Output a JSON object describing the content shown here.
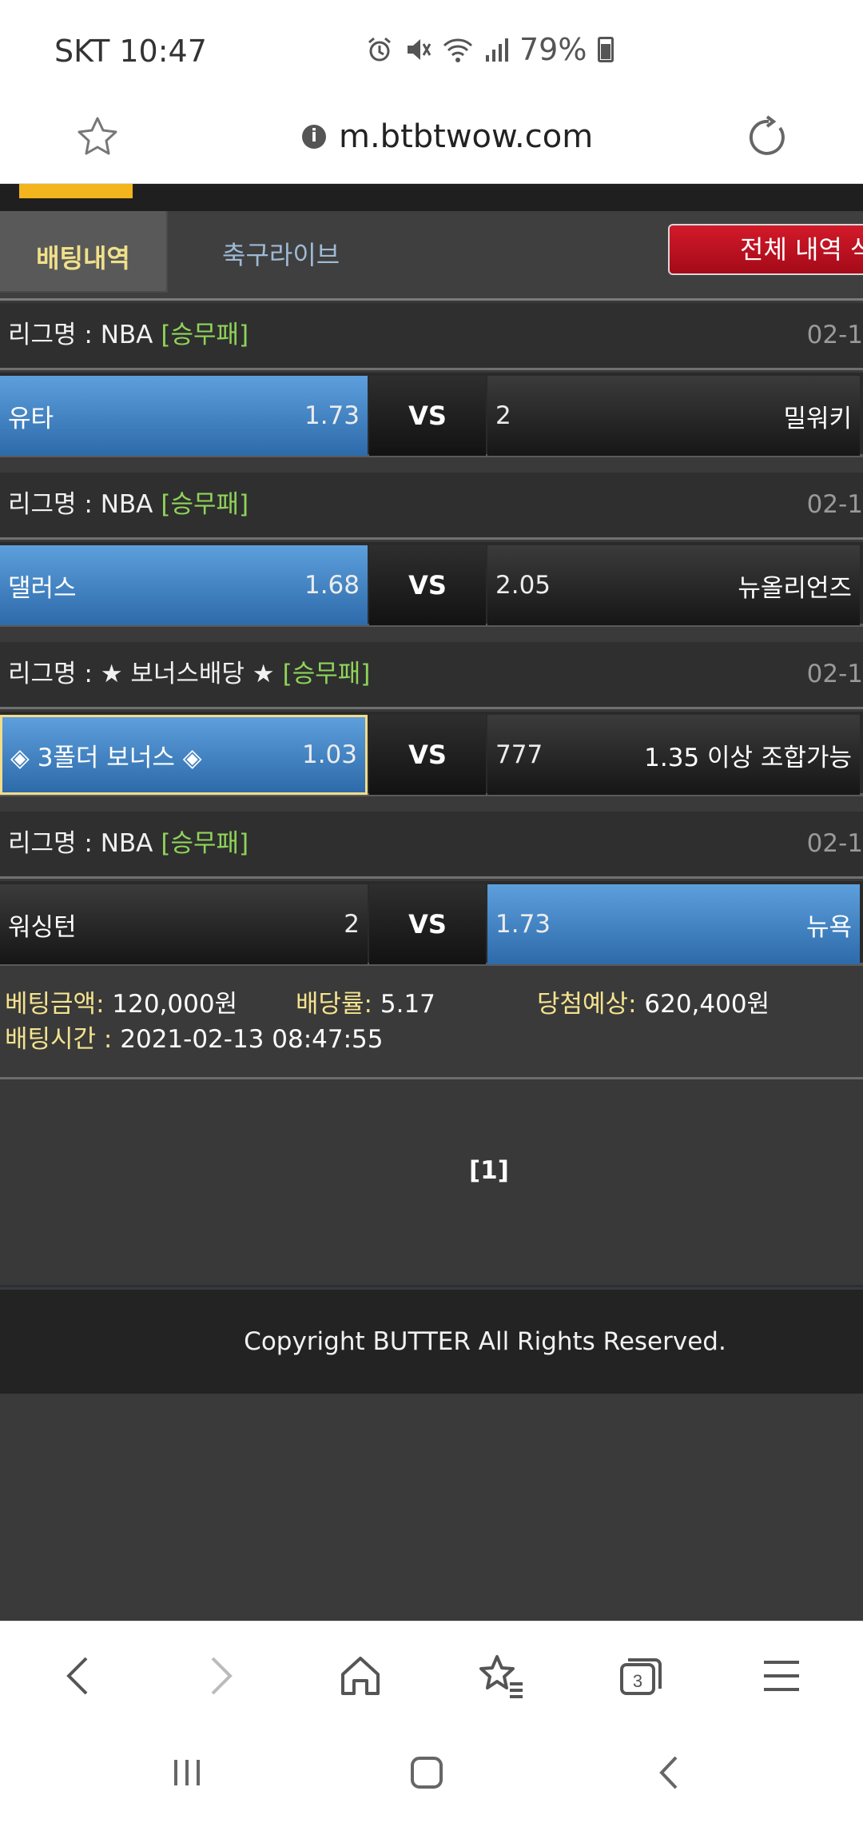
{
  "status_bar": {
    "carrier_time": "SKT 10:47",
    "battery": "79%",
    "icons": [
      "alarm-icon",
      "mute-icon",
      "wifi-icon",
      "signal-icon",
      "battery-icon"
    ]
  },
  "browser": {
    "url": "m.btbtwow.com"
  },
  "tabs": {
    "betting_history": "배팅내역",
    "soccer_live": "축구라이브",
    "delete_all": "전체 내역 삭"
  },
  "bets": [
    {
      "league": "리그명 : NBA",
      "type": "[승무패]",
      "date": "02-1",
      "home": "유타",
      "home_odds": "1.73",
      "vs": "VS",
      "draw": "2",
      "away": "밀워키",
      "selected": "home"
    },
    {
      "league": "리그명 : NBA",
      "type": "[승무패]",
      "date": "02-1",
      "home": "댈러스",
      "home_odds": "1.68",
      "vs": "VS",
      "draw": "2.05",
      "away": "뉴올리언즈",
      "selected": "home"
    },
    {
      "league": "리그명 : ★ 보너스배당 ★",
      "type": "[승무패]",
      "date": "02-1",
      "home": "◈ 3폴더 보너스 ◈",
      "home_odds": "1.03",
      "vs": "VS",
      "draw": "777",
      "away": "1.35 이상 조합가능",
      "selected": "home"
    },
    {
      "league": "리그명 : NBA",
      "type": "[승무패]",
      "date": "02-1",
      "home": "워싱턴",
      "home_odds": "2",
      "vs": "VS",
      "draw": "1.73",
      "away": "뉴욕",
      "selected": "away"
    }
  ],
  "summary": {
    "amount_label": "베팅금액:",
    "amount": "120,000원",
    "rate_label": "배당률:",
    "rate": "5.17",
    "win_label": "당첨예상:",
    "win": "620,400원",
    "time_label": "배팅시간 :",
    "time": "2021-02-13 08:47:55"
  },
  "pagination": "[1]",
  "footer": "Copyright BUTTER All Rights Reserved.",
  "toolbar": {
    "tabs_count": "3",
    "icons": [
      "back-icon",
      "forward-icon",
      "home-icon",
      "bookmarks-icon",
      "tabs-icon",
      "menu-icon"
    ]
  },
  "colors": {
    "selected_blue": "#3f82c6",
    "league_tag_green": "#8fd45a",
    "label_yellow": "#f4e38e",
    "delete_red": "#c01322"
  }
}
